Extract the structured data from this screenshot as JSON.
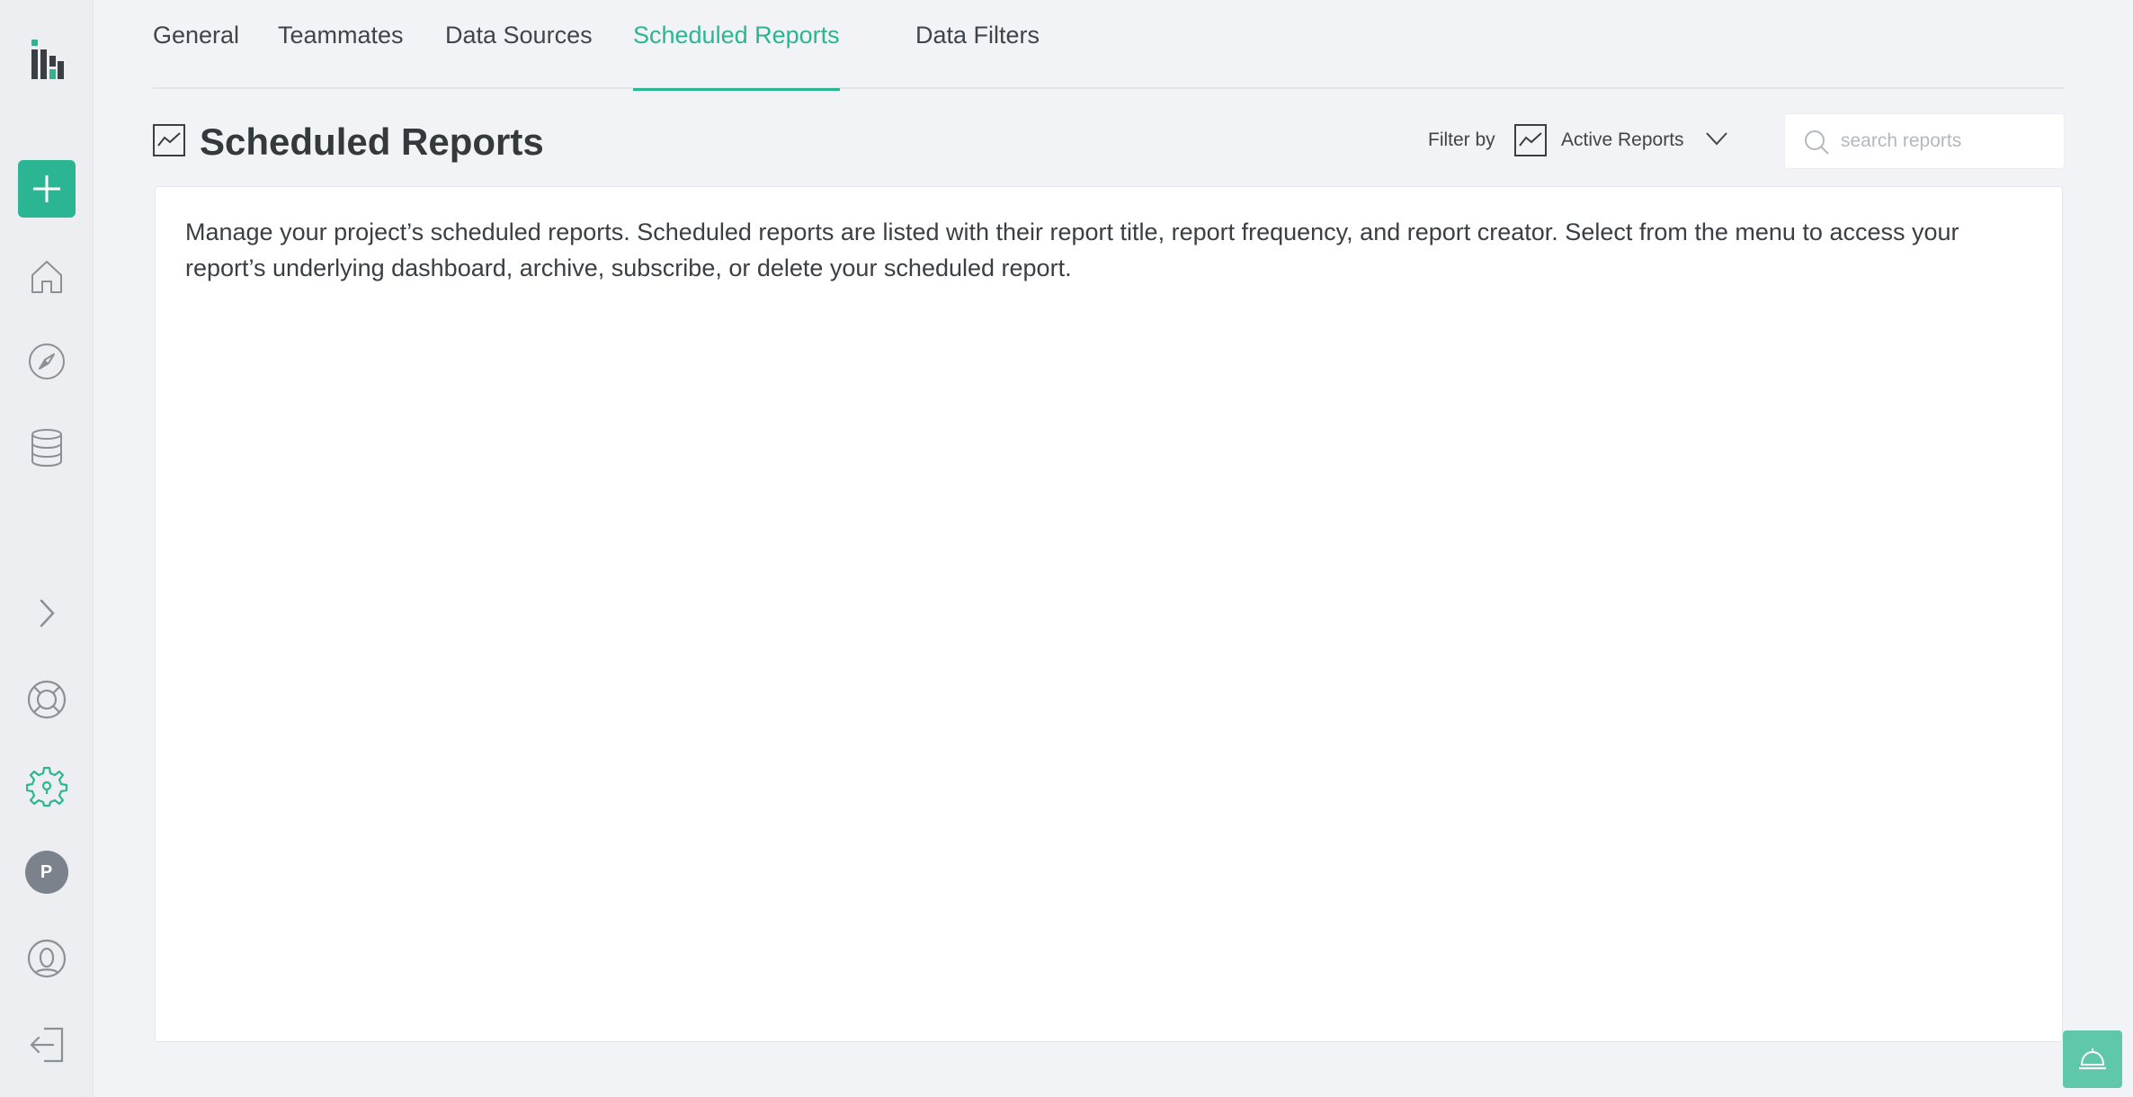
{
  "sidebar": {
    "logo": "logo-icon",
    "add": "plus-icon",
    "home": "home-icon",
    "explore": "compass-icon",
    "data": "database-icon",
    "expand": "chevron-right-icon",
    "help": "lifebuoy-icon",
    "settings": "gear-icon",
    "avatar_initial": "P",
    "profile": "user-circle-icon",
    "logout": "logout-icon"
  },
  "tabs": [
    {
      "label": "General",
      "active": false
    },
    {
      "label": "Teammates",
      "active": false
    },
    {
      "label": "Data Sources",
      "active": false
    },
    {
      "label": "Scheduled Reports",
      "active": true
    },
    {
      "label": "Data Filters",
      "active": false
    }
  ],
  "header": {
    "title": "Scheduled Reports",
    "filter_label": "Filter by",
    "filter_value": "Active Reports",
    "search_placeholder": "search reports"
  },
  "panel": {
    "description": "Manage your project’s scheduled reports. Scheduled reports are listed with their report title, report frequency, and report creator. Select from the menu to access your report’s underlying dashboard, archive, subscribe, or delete your scheduled report."
  },
  "colors": {
    "accent": "#2bb592",
    "help_button": "#5fc8ab",
    "avatar": "#7c828c"
  }
}
